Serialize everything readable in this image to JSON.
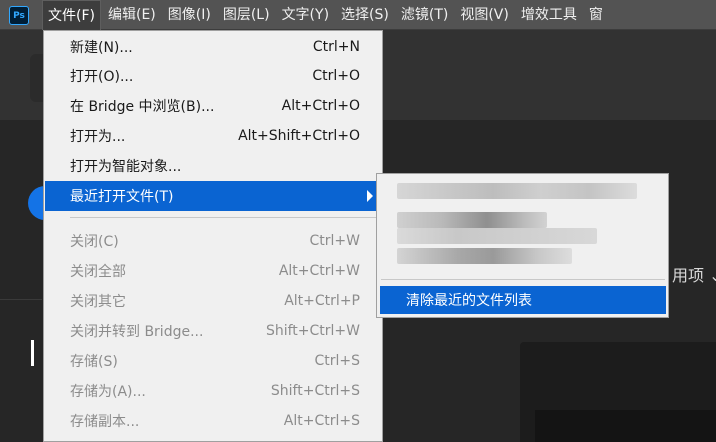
{
  "app": {
    "logo_text": "Ps"
  },
  "menubar": {
    "items": [
      {
        "label": "文件(F)"
      },
      {
        "label": "编辑(E)"
      },
      {
        "label": "图像(I)"
      },
      {
        "label": "图层(L)"
      },
      {
        "label": "文字(Y)"
      },
      {
        "label": "选择(S)"
      },
      {
        "label": "滤镜(T)"
      },
      {
        "label": "视图(V)"
      },
      {
        "label": "增效工具"
      },
      {
        "label": "窗"
      }
    ]
  },
  "file_menu": {
    "items": [
      {
        "label": "新建(N)...",
        "shortcut": "Ctrl+N"
      },
      {
        "label": "打开(O)...",
        "shortcut": "Ctrl+O"
      },
      {
        "label": "在 Bridge 中浏览(B)...",
        "shortcut": "Alt+Ctrl+O"
      },
      {
        "label": "打开为...",
        "shortcut": "Alt+Shift+Ctrl+O"
      },
      {
        "label": "打开为智能对象...",
        "shortcut": ""
      },
      {
        "label": "最近打开文件(T)",
        "shortcut": ""
      },
      {
        "label": "关闭(C)",
        "shortcut": "Ctrl+W"
      },
      {
        "label": "关闭全部",
        "shortcut": "Alt+Ctrl+W"
      },
      {
        "label": "关闭其它",
        "shortcut": "Alt+Ctrl+P"
      },
      {
        "label": "关闭并转到 Bridge...",
        "shortcut": "Shift+Ctrl+W"
      },
      {
        "label": "存储(S)",
        "shortcut": "Ctrl+S"
      },
      {
        "label": "存储为(A)...",
        "shortcut": "Shift+Ctrl+S"
      },
      {
        "label": "存储副本...",
        "shortcut": "Alt+Ctrl+S"
      }
    ]
  },
  "recent_files_submenu": {
    "clear_label": "清除最近的文件列表"
  },
  "background": {
    "right_label": "用项 ⌄"
  },
  "colors": {
    "highlight": "#0a64d2",
    "menu_bg": "#f0f0f0",
    "menubar_bg": "#535353",
    "disabled_text": "#8c8c8c",
    "ps_blue": "#31a8ff"
  }
}
